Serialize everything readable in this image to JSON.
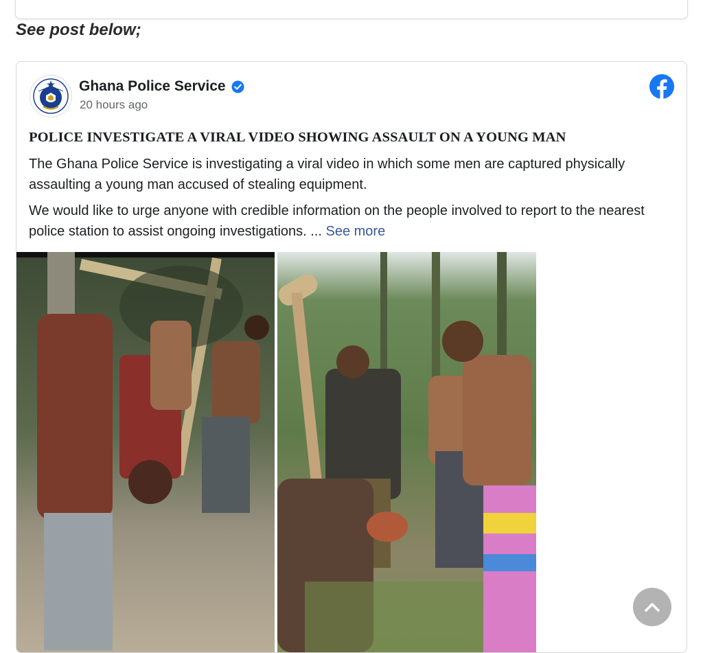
{
  "intro_text": "See post below;",
  "post": {
    "page_name": "Ghana Police Service",
    "timestamp": "20 hours ago",
    "headline": "POLICE INVESTIGATE A VIRAL VIDEO SHOWING ASSAULT ON A YOUNG MAN",
    "paragraph1": "The Ghana Police Service is investigating a viral video in which some men are captured physically assaulting a young man accused of stealing equipment.",
    "paragraph2": "We would like to urge anyone with credible information on the people involved to report to the nearest police station to assist ongoing investigations. ...",
    "see_more": "See more"
  },
  "icons": {
    "avatar": "ghana-police-logo",
    "verified": "verified-badge-icon",
    "platform": "facebook-icon",
    "scroll_top": "chevron-up-icon"
  },
  "colors": {
    "facebook_blue": "#1877f2",
    "link_blue": "#385898",
    "muted_text": "#65676b",
    "scroll_button": "#b3b3b3"
  }
}
